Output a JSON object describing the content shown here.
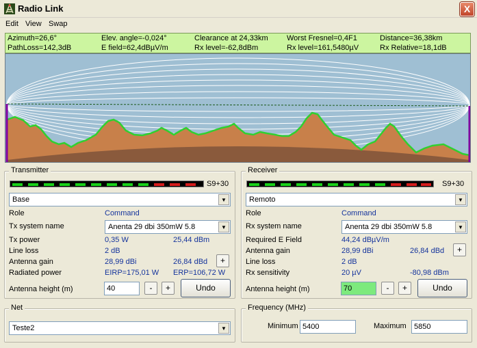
{
  "window": {
    "title": "Radio Link",
    "close": "X"
  },
  "menu": [
    {
      "label": "Edit"
    },
    {
      "label": "View"
    },
    {
      "label": "Swap"
    }
  ],
  "info": {
    "row1": [
      "Azimuth=26,6°",
      "Elev. angle=-0,024°",
      "Clearance at 24,33km",
      "Worst Fresnel=0,4F1",
      "Distance=36,38km"
    ],
    "row2": [
      "PathLoss=142,3dB",
      "E field=62,4dBµV/m",
      "Rx level=-62,8dBm",
      "Rx level=161,5480µV",
      "Rx Relative=18,1dB"
    ]
  },
  "colors": {
    "info_bg": "#ccf5a0",
    "sky": "#9fbfd3",
    "terrain": "#c8804a",
    "earth": "#8a5a3c",
    "profile_line": "#30d030",
    "value_text": "#14339c"
  },
  "transmitter": {
    "legend": "Transmitter",
    "signal_report": "S9+30",
    "meter": {
      "green_segments": 9,
      "red_segments": 3
    },
    "station": "Base",
    "role_label": "Role",
    "role_value": "Command",
    "system_label": "Tx system name",
    "system_value": "Anenta 29 dbi 350mW 5.8",
    "power_label": "Tx power",
    "power_w": "0,35 W",
    "power_dbm": "25,44 dBm",
    "line_loss_label": "Line loss",
    "line_loss_value": "2 dB",
    "gain_label": "Antenna gain",
    "gain_dbi": "28,99 dBi",
    "gain_dbd": "26,84 dBd",
    "plus": "+",
    "radiated_label": "Radiated power",
    "eirp": "EIRP=175,01 W",
    "erp": "ERP=106,72 W",
    "height_label": "Antenna height (m)",
    "height_value": "40",
    "minus": "-",
    "undo": "Undo"
  },
  "receiver": {
    "legend": "Receiver",
    "signal_report": "S9+30",
    "meter": {
      "green_segments": 9,
      "red_segments": 3
    },
    "station": "Remoto",
    "role_label": "Role",
    "role_value": "Command",
    "system_label": "Rx system name",
    "system_value": "Anenta 29 dbi 350mW 5.8",
    "field_label": "Required E Field",
    "field_value": "44,24 dBµV/m",
    "gain_label": "Antenna gain",
    "gain_dbi": "28,99 dBi",
    "gain_dbd": "26,84 dBd",
    "plus": "+",
    "line_loss_label": "Line loss",
    "line_loss_value": "2 dB",
    "sensitivity_label": "Rx sensitivity",
    "sensitivity_uv": "20 µV",
    "sensitivity_dbm": "-80,98 dBm",
    "height_label": "Antenna height (m)",
    "height_value": "70",
    "minus": "-",
    "undo": "Undo"
  },
  "net": {
    "legend": "Net",
    "value": "Teste2"
  },
  "frequency": {
    "legend": "Frequency (MHz)",
    "min_label": "Minimum",
    "min_value": "5400",
    "max_label": "Maximum",
    "max_value": "5850"
  }
}
